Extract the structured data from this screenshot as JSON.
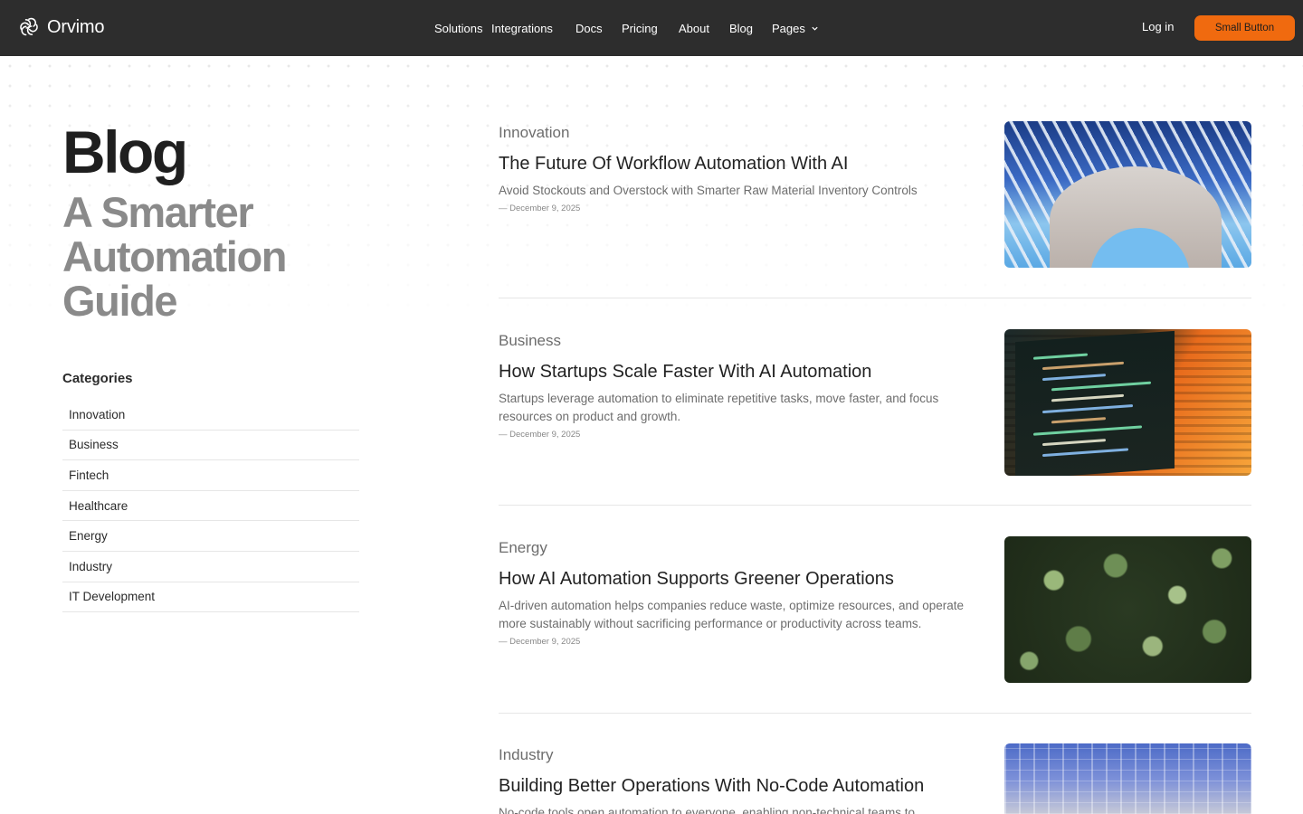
{
  "brand": {
    "name": "Orvimo"
  },
  "nav": {
    "links": [
      "Solutions",
      "Integrations",
      "Docs",
      "Pricing",
      "About",
      "Blog",
      "Pages"
    ],
    "login_label": "Log in",
    "cta_label": "Small Button"
  },
  "colors": {
    "navbar": "#2d2d2d",
    "accent": "#f06a0f"
  },
  "hero": {
    "title": "Blog",
    "subtitle": "A Smarter Automation Guide"
  },
  "categories": {
    "title": "Categories",
    "items": [
      "Innovation",
      "Business",
      "Fintech",
      "Healthcare",
      "Energy",
      "Industry",
      "IT Development"
    ]
  },
  "posts": [
    {
      "category": "Innovation",
      "title": "The Future Of Workflow Automation With AI",
      "excerpt": "Avoid Stockouts and Overstock with Smarter Raw Material Inventory Controls",
      "date": "— December 9, 2025",
      "image": "modern-architecture-image"
    },
    {
      "category": "Business",
      "title": "How Startups Scale Faster With AI Automation",
      "excerpt": "Startups leverage automation to eliminate repetitive tasks, move faster, and focus resources on product and growth.",
      "date": "— December 9, 2025",
      "image": "code-screen-image"
    },
    {
      "category": "Energy",
      "title": "How AI Automation Supports Greener Operations",
      "excerpt": "AI-driven automation helps companies reduce waste, optimize resources, and operate more sustainably without sacrificing performance or productivity across teams.",
      "date": "— December 9, 2025",
      "image": "forest-aerial-image"
    },
    {
      "category": "Industry",
      "title": "Building Better Operations With No-Code Automation",
      "excerpt": "No-code tools open automation to everyone, enabling non-technical teams to",
      "date": "",
      "image": "factory-image"
    }
  ]
}
